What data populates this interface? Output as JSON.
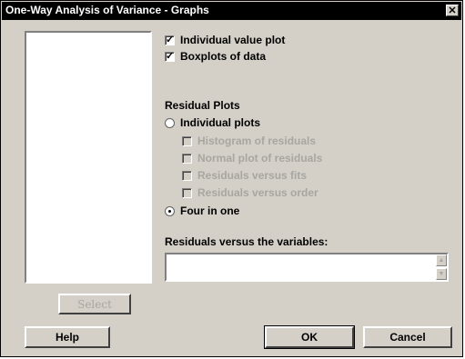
{
  "window": {
    "title": "One-Way Analysis of Variance - Graphs",
    "close_glyph": "✕"
  },
  "options": {
    "individual_value_plot": {
      "label": "Individual value plot",
      "checked": true
    },
    "boxplots": {
      "label": "Boxplots of data",
      "checked": true
    }
  },
  "residual_plots": {
    "heading": "Residual Plots",
    "individual_plots": {
      "label": "Individual plots",
      "selected": false
    },
    "histogram": {
      "label": "Histogram of residuals",
      "enabled": false
    },
    "normal_plot": {
      "label": "Normal plot of residuals",
      "enabled": false
    },
    "residuals_vs_fits": {
      "label": "Residuals versus fits",
      "enabled": false
    },
    "residuals_vs_order": {
      "label": "Residuals versus order",
      "enabled": false
    },
    "four_in_one": {
      "label": "Four in one",
      "selected": true
    }
  },
  "variables_field": {
    "label": "Residuals versus the variables:",
    "value": ""
  },
  "buttons": {
    "select": "Select",
    "help": "Help",
    "ok": "OK",
    "cancel": "Cancel"
  },
  "icons": {
    "check": "✓",
    "scroll_up": "▲",
    "scroll_down": "▼"
  }
}
